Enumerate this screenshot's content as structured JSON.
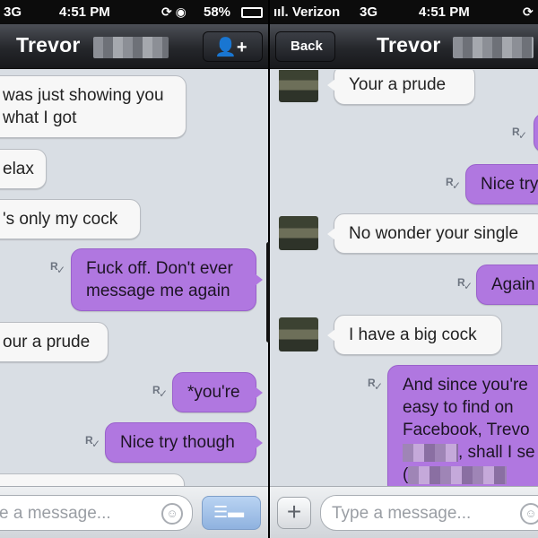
{
  "left": {
    "status": {
      "carrier": "3G",
      "time": "4:51 PM",
      "battery": "58%"
    },
    "nav": {
      "title": "Trevor",
      "add_contact_icon": "add-contact-icon"
    },
    "messages": [
      {
        "dir": "in",
        "lines": [
          "was just showing you",
          "what I got"
        ]
      },
      {
        "dir": "in",
        "lines": [
          "elax"
        ]
      },
      {
        "dir": "in",
        "lines": [
          "'s only my cock"
        ]
      },
      {
        "dir": "out",
        "lines": [
          "Fuck off. Don't ever",
          "message me again"
        ],
        "read_icon": "R✓"
      },
      {
        "dir": "in",
        "lines": [
          "our a prude"
        ]
      },
      {
        "dir": "out",
        "lines": [
          "*you're"
        ],
        "read_icon": "R✓"
      },
      {
        "dir": "out",
        "lines": [
          "Nice try though"
        ],
        "read_icon": "R✓"
      }
    ],
    "composer": {
      "placeholder": "e a message..."
    }
  },
  "right": {
    "status": {
      "signal": "ııl. Verizon",
      "network": "3G",
      "time": "4:51 PM"
    },
    "nav": {
      "back_label": "Back",
      "title": "Trevor"
    },
    "messages": [
      {
        "dir": "in",
        "lines": [
          "Your a prude"
        ]
      },
      {
        "dir": "out",
        "lines": [
          ""
        ],
        "read_icon": "R✓"
      },
      {
        "dir": "out",
        "lines": [
          "Nice try"
        ],
        "read_icon": "R✓"
      },
      {
        "dir": "in",
        "lines": [
          "No wonder your single"
        ]
      },
      {
        "dir": "out",
        "lines": [
          "Again"
        ],
        "read_icon": "R✓"
      },
      {
        "dir": "in",
        "lines": [
          "I have a big cock"
        ]
      },
      {
        "dir": "out",
        "lines": [
          "And since you're",
          "easy to find on",
          "Facebook, Trevo",
          ", shall I se",
          "("
        ],
        "read_icon": "R✓"
      }
    ],
    "composer": {
      "placeholder": "Type a message..."
    }
  },
  "colors": {
    "outgoing": "#b077e0",
    "incoming": "#f7f7f7",
    "chat_bg": "#d9dee4",
    "nav_bg": "#25272b"
  }
}
